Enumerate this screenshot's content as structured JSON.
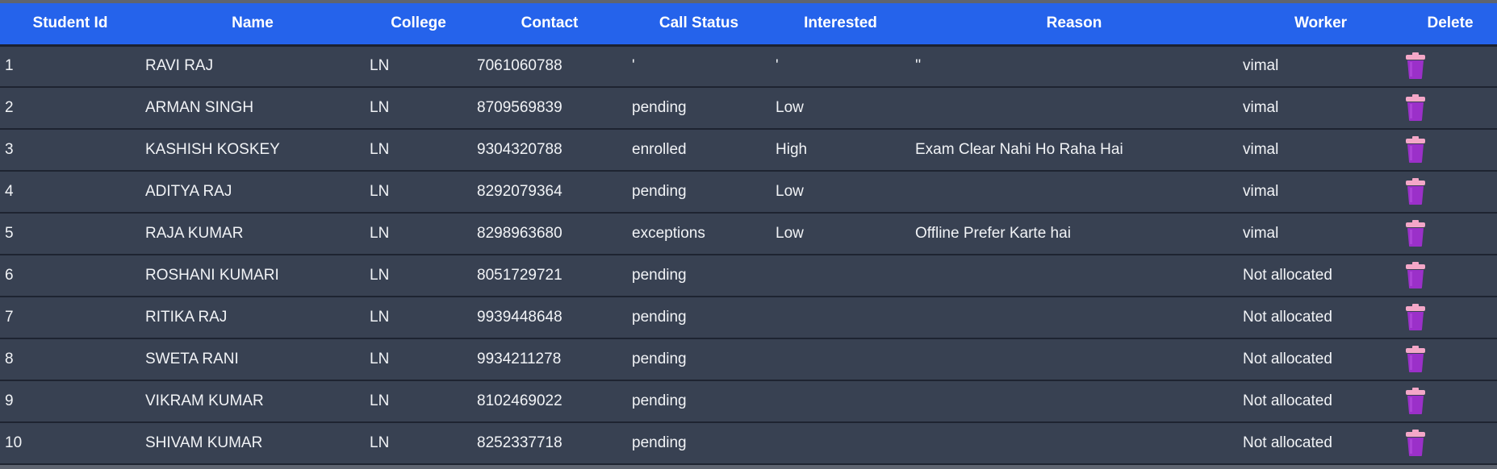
{
  "colors": {
    "header_bg": "#2563eb",
    "row_bg": "#384152",
    "row_border": "#1e2431",
    "text": "#f1f3f6",
    "trash_body": "#9b30c9",
    "trash_lid": "#f4a7c8"
  },
  "table": {
    "headers": [
      "Student Id",
      "Name",
      "College",
      "Contact",
      "Call Status",
      "Interested",
      "Reason",
      "Worker",
      "Delete"
    ],
    "rows": [
      {
        "id": "1",
        "name": "RAVI RAJ",
        "college": "LN",
        "contact": "7061060788",
        "call_status": "'",
        "interested": "'",
        "reason": "''",
        "worker": "vimal",
        "delete_icon": "trash-icon"
      },
      {
        "id": "2",
        "name": "ARMAN SINGH",
        "college": "LN",
        "contact": "8709569839",
        "call_status": "pending",
        "interested": "Low",
        "reason": "",
        "worker": "vimal",
        "delete_icon": "trash-icon"
      },
      {
        "id": "3",
        "name": "KASHISH KOSKEY",
        "college": "LN",
        "contact": "9304320788",
        "call_status": "enrolled",
        "interested": "High",
        "reason": "Exam Clear Nahi Ho Raha Hai",
        "worker": "vimal",
        "delete_icon": "trash-icon"
      },
      {
        "id": "4",
        "name": "ADITYA RAJ",
        "college": "LN",
        "contact": "8292079364",
        "call_status": "pending",
        "interested": "Low",
        "reason": "",
        "worker": "vimal",
        "delete_icon": "trash-icon"
      },
      {
        "id": "5",
        "name": "RAJA KUMAR",
        "college": "LN",
        "contact": "8298963680",
        "call_status": "exceptions",
        "interested": "Low",
        "reason": "Offline Prefer Karte hai",
        "worker": "vimal",
        "delete_icon": "trash-icon"
      },
      {
        "id": "6",
        "name": "ROSHANI KUMARI",
        "college": "LN",
        "contact": "8051729721",
        "call_status": "pending",
        "interested": "",
        "reason": "",
        "worker": "Not allocated",
        "delete_icon": "trash-icon"
      },
      {
        "id": "7",
        "name": "RITIKA RAJ",
        "college": "LN",
        "contact": "9939448648",
        "call_status": "pending",
        "interested": "",
        "reason": "",
        "worker": "Not allocated",
        "delete_icon": "trash-icon"
      },
      {
        "id": "8",
        "name": "SWETA RANI",
        "college": "LN",
        "contact": "9934211278",
        "call_status": "pending",
        "interested": "",
        "reason": "",
        "worker": "Not allocated",
        "delete_icon": "trash-icon"
      },
      {
        "id": "9",
        "name": "VIKRAM KUMAR",
        "college": "LN",
        "contact": "8102469022",
        "call_status": "pending",
        "interested": "",
        "reason": "",
        "worker": "Not allocated",
        "delete_icon": "trash-icon"
      },
      {
        "id": "10",
        "name": "SHIVAM KUMAR",
        "college": "LN",
        "contact": "8252337718",
        "call_status": "pending",
        "interested": "",
        "reason": "",
        "worker": "Not allocated",
        "delete_icon": "trash-icon"
      }
    ]
  }
}
